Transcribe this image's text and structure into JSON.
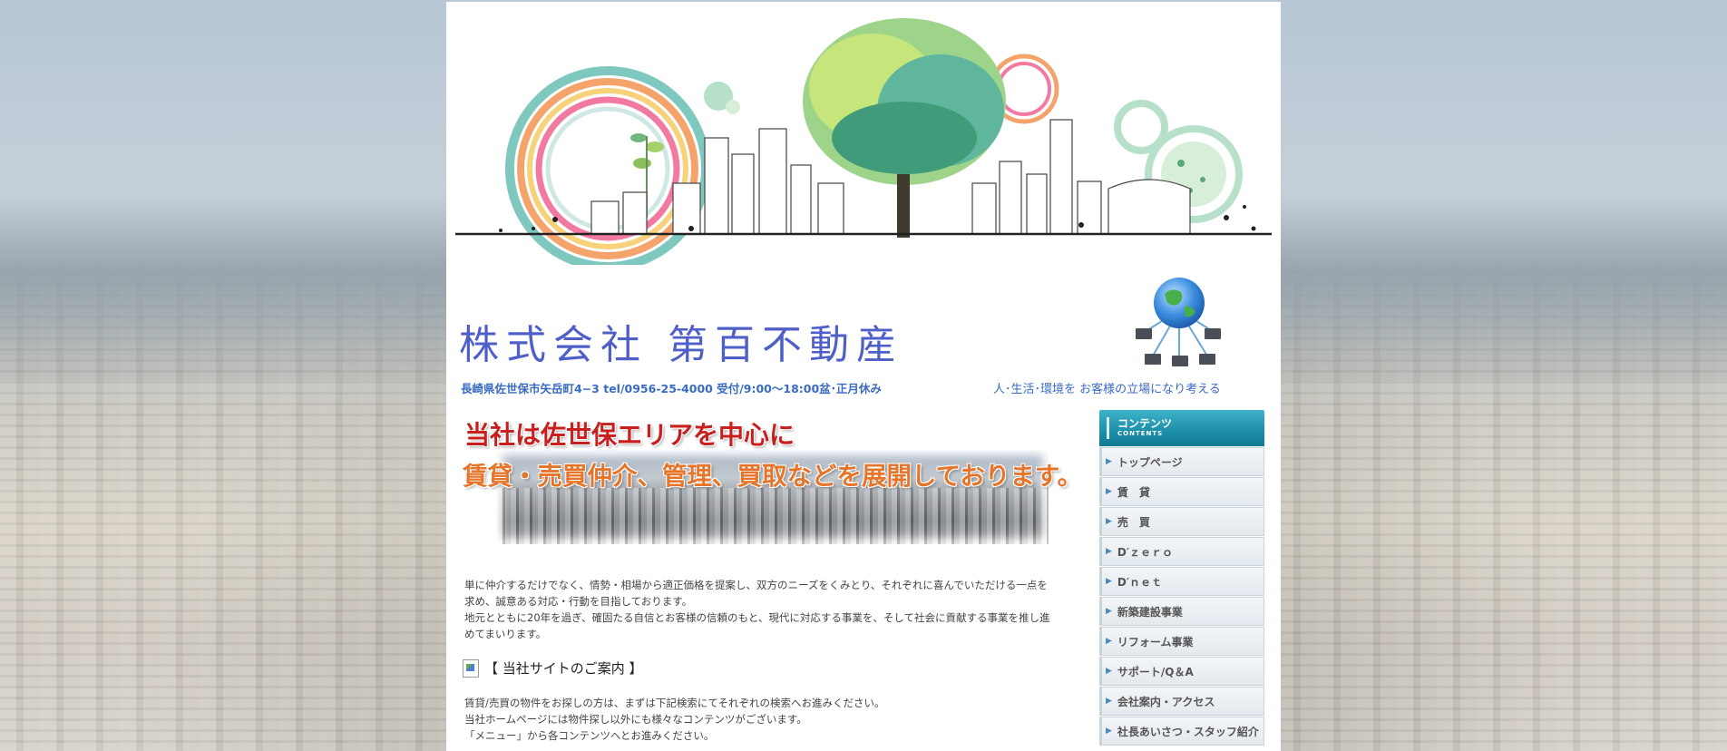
{
  "header": {
    "company_name": "株式会社 第百不動産",
    "address": "長崎県佐世保市矢岳町4−3 tel/0956-25-4000 受付/9:00〜18:00盆･正月休み",
    "tagline": "人･生活･環境を お客様の立場になり考える"
  },
  "hero": {
    "line1": "当社は佐世保エリアを中心に",
    "line2": "賃貸・売買仲介、管理、買取などを展開しております。"
  },
  "intro": {
    "p1": "単に仲介するだけでなく、情勢・相場から適正価格を提案し、双方のニーズをくみとり、それぞれに喜んでいただける一点を",
    "p2": "求め、誠意ある対応・行動を目指しております。",
    "p3": "地元とともに20年を過ぎ、確固たる自信とお客様の信頼のもと、現代に対応する事業を、そして社会に貢献する事業を推し進",
    "p4": "めてまいります。"
  },
  "guide": {
    "heading": "【 当社サイトのご案内 】",
    "line1": "賃貸/売買の物件をお探しの方は、まずは下記検索にてそれぞれの検索へお進みください。",
    "line2": "当社ホームページには物件探し以外にも様々なコンテンツがございます。",
    "line3": "「メニュー」から各コンテンツへとお進みください。"
  },
  "sidebar": {
    "title": "コンテンツ",
    "subtitle": "CONTENTS",
    "items": [
      {
        "label": "トップページ"
      },
      {
        "label": "賃　貸"
      },
      {
        "label": "売　買"
      },
      {
        "label": "D′ｚｅｒｏ"
      },
      {
        "label": "D′ｎｅｔ"
      },
      {
        "label": "新築建設事業"
      },
      {
        "label": "リフォーム事業"
      },
      {
        "label": "サポート/Q＆A"
      },
      {
        "label": "会社案内・アクセス"
      },
      {
        "label": "社長あいさつ・スタッフ紹介"
      }
    ]
  },
  "colors": {
    "brand_blue": "#4f5fc8",
    "accent_teal": "#1c8ea8",
    "hero_red": "#c8201f",
    "hero_orange": "#e4752a"
  }
}
